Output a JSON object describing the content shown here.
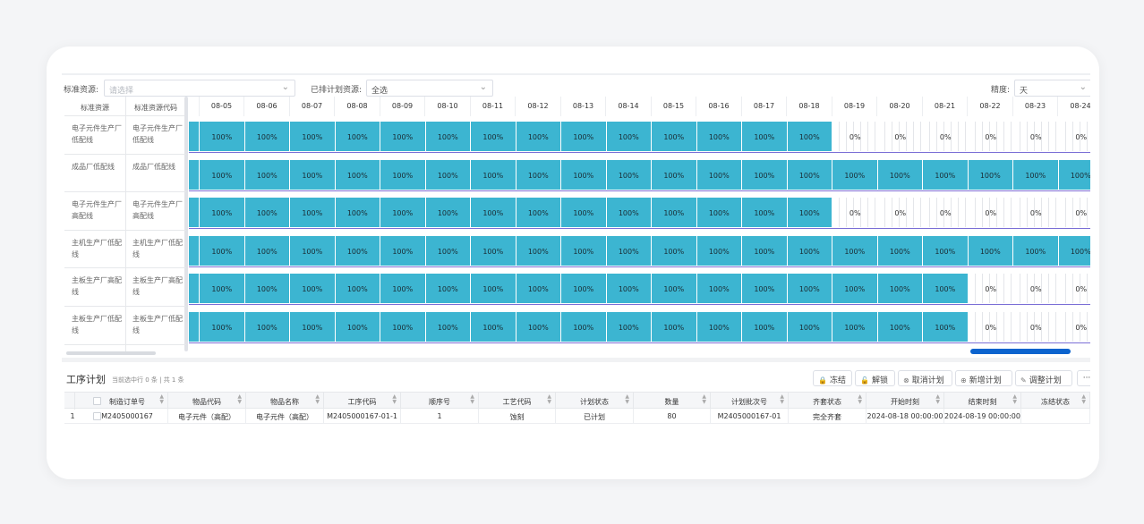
{
  "filters": {
    "std_resource_label": "标准资源:",
    "std_resource_placeholder": "请选择",
    "scheduled_label": "已排计划资源:",
    "scheduled_value": "全选",
    "precision_label": "精度:",
    "precision_value": "天"
  },
  "gantt": {
    "left_headers": [
      "标准资源",
      "标准资源代码"
    ],
    "resources": [
      {
        "name": "电子元件生产厂低配线",
        "code": "电子元件生产厂低配线",
        "name_lines": [
          "电子元件生产厂",
          "低配线"
        ],
        "code_lines": [
          "电子元件生产厂",
          "低配线"
        ],
        "full_count": 14
      },
      {
        "name": "成品厂低配线",
        "code": "成品厂低配线",
        "name_lines": [
          "成品厂低配线"
        ],
        "code_lines": [
          "成品厂低配线"
        ],
        "full_count": 20
      },
      {
        "name": "电子元件生产厂高配线",
        "code": "电子元件生产厂高配线",
        "name_lines": [
          "电子元件生产厂",
          "高配线"
        ],
        "code_lines": [
          "电子元件生产厂",
          "高配线"
        ],
        "full_count": 14
      },
      {
        "name": "主机生产厂低配线",
        "code": "主机生产厂低配线",
        "name_lines": [
          "主机生产厂低配",
          "线"
        ],
        "code_lines": [
          "主机生产厂低配",
          "线"
        ],
        "full_count": 20
      },
      {
        "name": "主板生产厂高配线",
        "code": "主板生产厂高配线",
        "name_lines": [
          "主板生产厂高配",
          "线"
        ],
        "code_lines": [
          "主板生产厂高配",
          "线"
        ],
        "full_count": 17
      },
      {
        "name": "主板生产厂低配线",
        "code": "主板生产厂低配线",
        "name_lines": [
          "主板生产厂低配",
          "线"
        ],
        "code_lines": [
          "主板生产厂低配",
          "线"
        ],
        "full_count": 17
      }
    ],
    "dates": [
      "08-05",
      "08-06",
      "08-07",
      "08-08",
      "08-09",
      "08-10",
      "08-11",
      "08-12",
      "08-13",
      "08-14",
      "08-15",
      "08-16",
      "08-17",
      "08-18",
      "08-19",
      "08-20",
      "08-21",
      "08-22",
      "08-23",
      "08-24"
    ],
    "full_label": "100%",
    "empty_label": "0%"
  },
  "plan": {
    "title": "工序计划",
    "subtitle": "当前选中行 0 条 | 共 1 条",
    "buttons": [
      {
        "name": "freeze-button",
        "icon": "lock-icon",
        "glyph": "🔒",
        "label": "冻结"
      },
      {
        "name": "unfreeze-button",
        "icon": "unlock-icon",
        "glyph": "🔓",
        "label": "解锁"
      },
      {
        "name": "cancel-plan-button",
        "icon": "cancel-icon",
        "glyph": "⊗",
        "label": "取消计划"
      },
      {
        "name": "add-plan-button",
        "icon": "add-icon",
        "glyph": "⊕",
        "label": "新增计划"
      },
      {
        "name": "adjust-plan-button",
        "icon": "edit-icon",
        "glyph": "✎",
        "label": "调整计划"
      }
    ],
    "more_label": "···",
    "columns": [
      "制造订单号",
      "物品代码",
      "物品名称",
      "工序代码",
      "顺序号",
      "工艺代码",
      "计划状态",
      "数量",
      "计划批次号",
      "齐套状态",
      "开始时刻",
      "结束时刻",
      "冻结状态"
    ],
    "rows": [
      {
        "index": "1",
        "cells": [
          "M2405000167",
          "电子元件（高配）",
          "电子元件（高配）",
          "M2405000167-01-1",
          "1",
          "蚀刻",
          "已计划",
          "80",
          "M2405000167-01",
          "完全齐套",
          "2024-08-18 00:00:00",
          "2024-08-19 00:00:00",
          ""
        ]
      }
    ]
  }
}
